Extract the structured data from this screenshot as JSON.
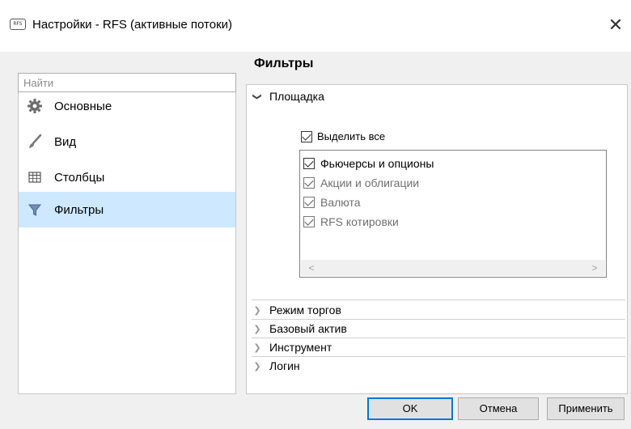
{
  "window": {
    "icon_text": "RFS",
    "title": "Настройки - RFS (активные потоки)",
    "close_glyph": "✕"
  },
  "search": {
    "value": "",
    "placeholder": "Найти"
  },
  "nav": {
    "items": [
      {
        "label": "Основные",
        "icon": "gear-icon",
        "selected": false
      },
      {
        "label": "Вид",
        "icon": "brush-icon",
        "selected": false
      },
      {
        "label": "Столбцы",
        "icon": "columns-icon",
        "selected": false
      },
      {
        "label": "Фильтры",
        "icon": "filter-icon",
        "selected": true
      }
    ]
  },
  "filters": {
    "title": "Фильтры",
    "venue": {
      "header": "Площадка",
      "expanded": true,
      "select_all_label": "Выделить все",
      "select_all_checked": true,
      "items": [
        {
          "label": "Фьючерсы и опционы",
          "checked": true,
          "enabled": true
        },
        {
          "label": "Акции и облигации",
          "checked": true,
          "enabled": false
        },
        {
          "label": "Валюта",
          "checked": true,
          "enabled": false
        },
        {
          "label": "RFS котировки",
          "checked": true,
          "enabled": false
        }
      ],
      "scroll_left": "<",
      "scroll_right": ">"
    },
    "sections": [
      {
        "label": "Режим торгов",
        "expanded": false
      },
      {
        "label": "Базовый актив",
        "expanded": false
      },
      {
        "label": "Инструмент",
        "expanded": false
      },
      {
        "label": "Логин",
        "expanded": false
      }
    ]
  },
  "buttons": {
    "ok": "OK",
    "cancel": "Отмена",
    "apply": "Применить"
  },
  "colors": {
    "selection": "#cde8ff",
    "primary_border": "#0078d7"
  }
}
